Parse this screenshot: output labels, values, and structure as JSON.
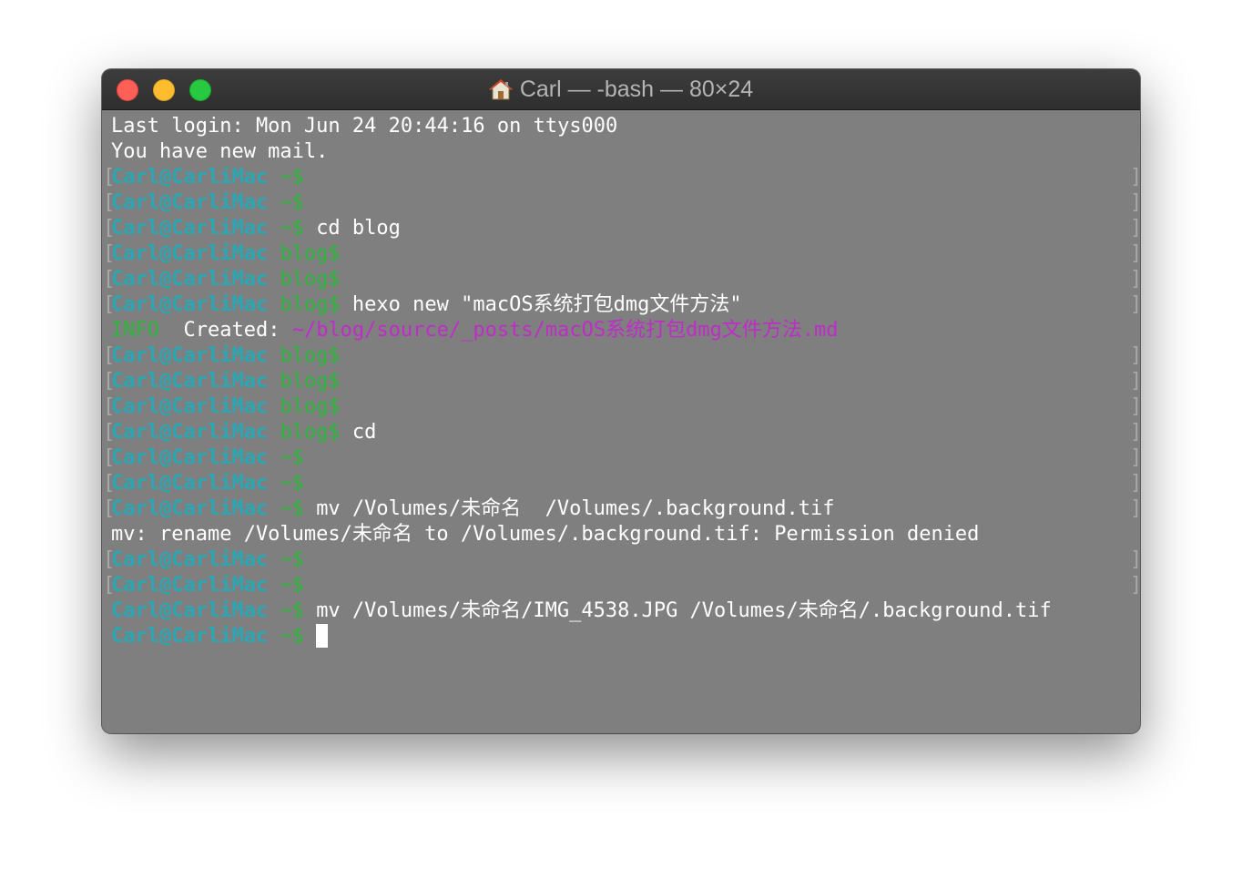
{
  "window": {
    "title": "Carl — -bash — 80×24",
    "title_icon": "home-icon",
    "traffic_lights": {
      "close_color": "#fe5f57",
      "minimize_color": "#febc2e",
      "zoom_color": "#28c840"
    }
  },
  "colors": {
    "background": "#7f7f7f",
    "user_host": "#2aa7b3",
    "directory": "#2cb73c",
    "command": "#ffffff",
    "info": "#2cb73c",
    "file_path": "#c02cc8"
  },
  "prompt": {
    "user_host": "Carl@CarliMac",
    "home_dir": "~$",
    "blog_dir": "blog$"
  },
  "terminal": {
    "login": "Last login: Mon Jun 24 20:44:16 on ttys000",
    "mail": "You have new mail.",
    "cmd_cd_blog": "cd blog",
    "cmd_hexo_new": "hexo new \"macOS系统打包dmg文件方法\"",
    "info_label": "INFO",
    "created_label": "Created:",
    "created_path": "~/blog/source/_posts/macOS系统打包dmg文件方法.md",
    "cmd_cd": "cd",
    "cmd_mv_1": "mv /Volumes/未命名  /Volumes/.background.tif",
    "error_mv": "mv: rename /Volumes/未命名 to /Volumes/.background.tif: Permission denied",
    "cmd_mv_2": "mv /Volumes/未命名/IMG_4538.JPG /Volumes/未命名/.background.tif"
  }
}
